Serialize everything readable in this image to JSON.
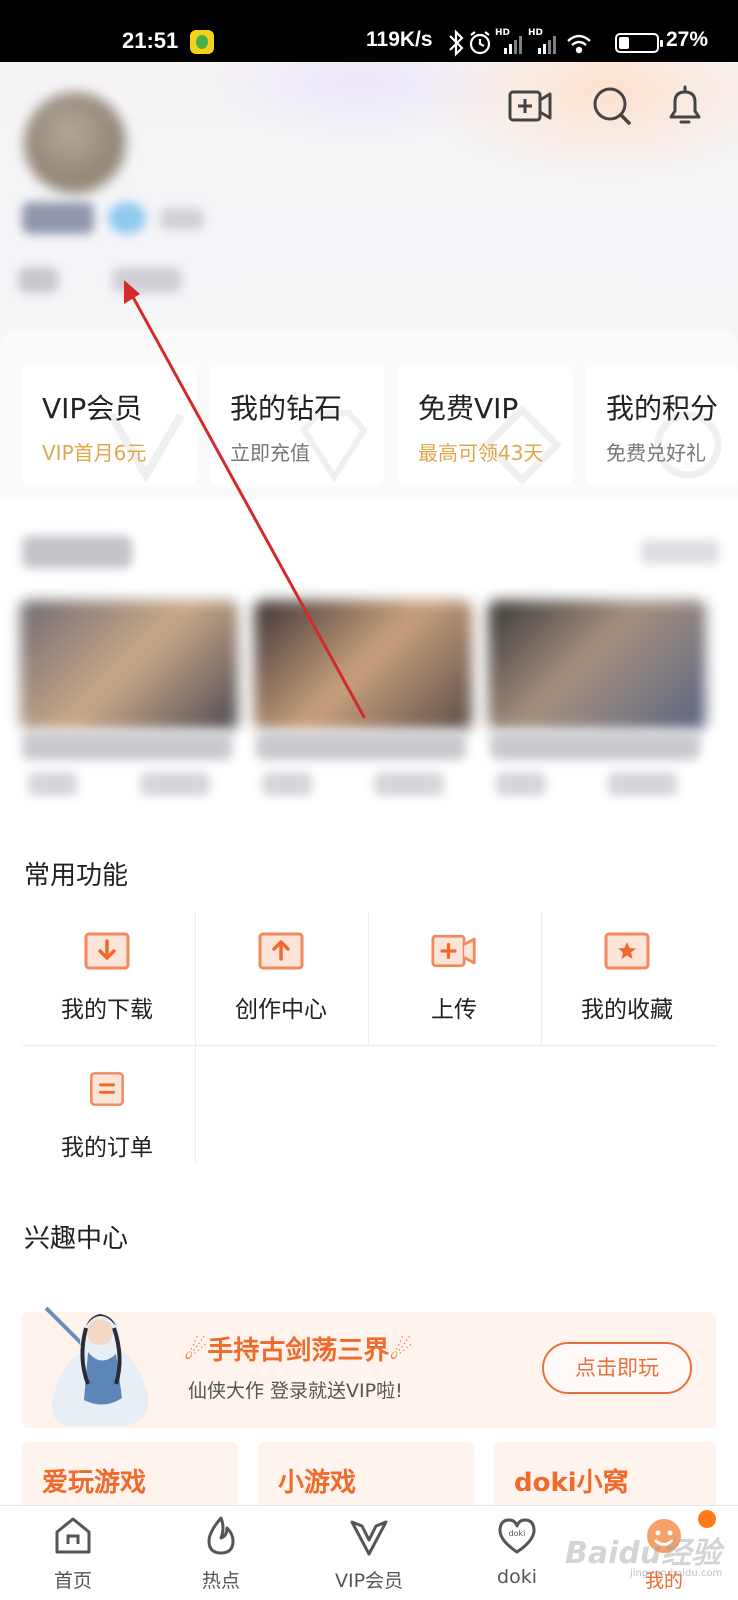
{
  "status_bar": {
    "time": "21:51",
    "speed": "119K/s",
    "hd1": "HD",
    "hd2": "HD",
    "battery": "27%"
  },
  "header": {
    "icons": [
      "video-add-icon",
      "search-icon",
      "bell-icon"
    ]
  },
  "cards": [
    {
      "title": "VIP会员",
      "sub": "VIP首月6元",
      "sub_color": "#e0a84a"
    },
    {
      "title": "我的钻石",
      "sub": "立即充值",
      "sub_color": "#777777"
    },
    {
      "title": "免费VIP",
      "sub": "最高可领43天",
      "sub_color": "#e0a84a"
    },
    {
      "title": "我的积分",
      "sub": "免费兑好礼",
      "sub_color": "#777777"
    }
  ],
  "functions": {
    "title": "常用功能",
    "items": [
      {
        "label": "我的下载",
        "icon": "download-icon"
      },
      {
        "label": "创作中心",
        "icon": "upload-box-icon"
      },
      {
        "label": "上传",
        "icon": "video-upload-icon"
      },
      {
        "label": "我的收藏",
        "icon": "star-icon"
      },
      {
        "label": "我的订单",
        "icon": "order-icon"
      }
    ]
  },
  "interest": {
    "title": "兴趣中心",
    "promo_title": "手持古剑荡三界",
    "promo_sub": "仙侠大作 登录就送VIP啦!",
    "promo_button": "点击即玩",
    "tiles": [
      "爱玩游戏",
      "小游戏",
      "doki小窝"
    ]
  },
  "bottom_nav": [
    {
      "label": "首页",
      "icon": "home-icon",
      "active": false
    },
    {
      "label": "热点",
      "icon": "flame-icon",
      "active": false
    },
    {
      "label": "VIP会员",
      "icon": "vip-icon",
      "active": false
    },
    {
      "label": "doki",
      "icon": "doki-heart-icon",
      "active": false
    },
    {
      "label": "我的",
      "icon": "profile-face-icon",
      "active": true
    }
  ],
  "watermark": {
    "brand": "Baidu经验",
    "url": "jingyan.baidu.com"
  },
  "colors": {
    "accent": "#f06a2c",
    "gold": "#e0a84a",
    "icon_orange": "#f08a5d"
  }
}
